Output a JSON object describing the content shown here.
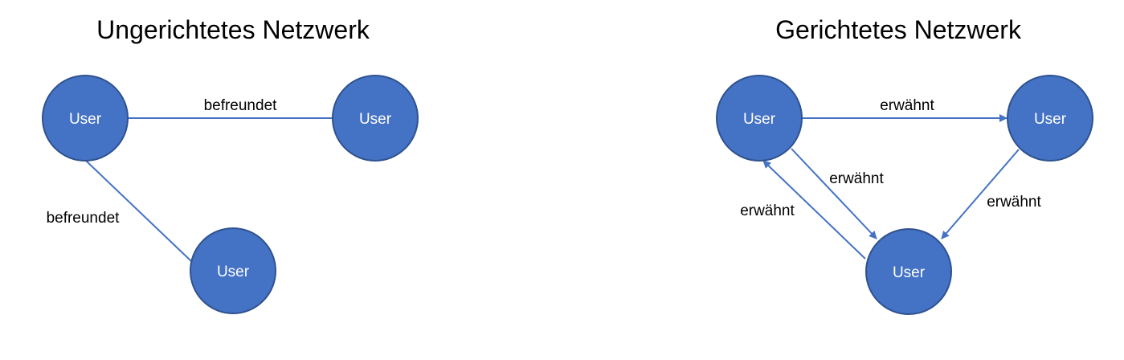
{
  "undirected": {
    "title": "Ungerichtetes Netzwerk",
    "nodes": [
      {
        "label": "User"
      },
      {
        "label": "User"
      },
      {
        "label": "User"
      }
    ],
    "edges": [
      {
        "from": 0,
        "to": 1,
        "label": "befreundet"
      },
      {
        "from": 0,
        "to": 2,
        "label": "befreundet"
      }
    ]
  },
  "directed": {
    "title": "Gerichtetes Netzwerk",
    "nodes": [
      {
        "label": "User"
      },
      {
        "label": "User"
      },
      {
        "label": "User"
      }
    ],
    "edges": [
      {
        "from": 0,
        "to": 1,
        "label": "erwähnt"
      },
      {
        "from": 0,
        "to": 2,
        "label": "erwähnt"
      },
      {
        "from": 2,
        "to": 0,
        "label": "erwähnt"
      },
      {
        "from": 1,
        "to": 2,
        "label": "erwähnt"
      }
    ]
  },
  "colors": {
    "node_fill": "#4472c4",
    "node_stroke": "#2f528f",
    "edge": "#4472c4",
    "node_text": "#ffffff",
    "text": "#000000"
  }
}
